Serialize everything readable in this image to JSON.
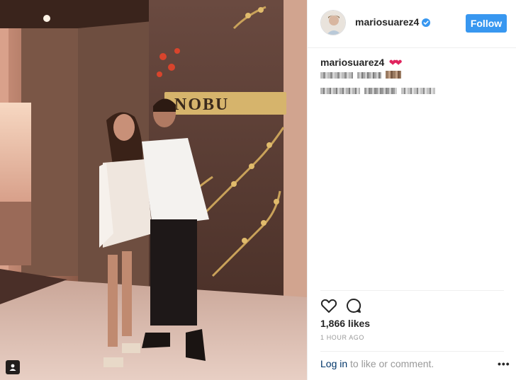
{
  "post": {
    "username": "mariosuarez4",
    "follow_label": "Follow",
    "caption_user": "mariosuarez4",
    "caption_emoji": "❤❤",
    "likes": "1,866 likes",
    "timestamp": "1 HOUR AGO",
    "login_link": "Log in",
    "login_rest": " to like or comment.",
    "more_label": "•••"
  },
  "photo": {
    "sign_text": "NOBU"
  },
  "colors": {
    "follow_button": "#3897f0",
    "verified_badge": "#3897f0",
    "text_primary": "#262626",
    "text_secondary": "#999999",
    "link": "#003569"
  },
  "icons": {
    "like": "heart-outline-icon",
    "comment": "comment-bubble-icon",
    "verified": "verified-check-icon",
    "tagged": "person-tag-icon"
  }
}
